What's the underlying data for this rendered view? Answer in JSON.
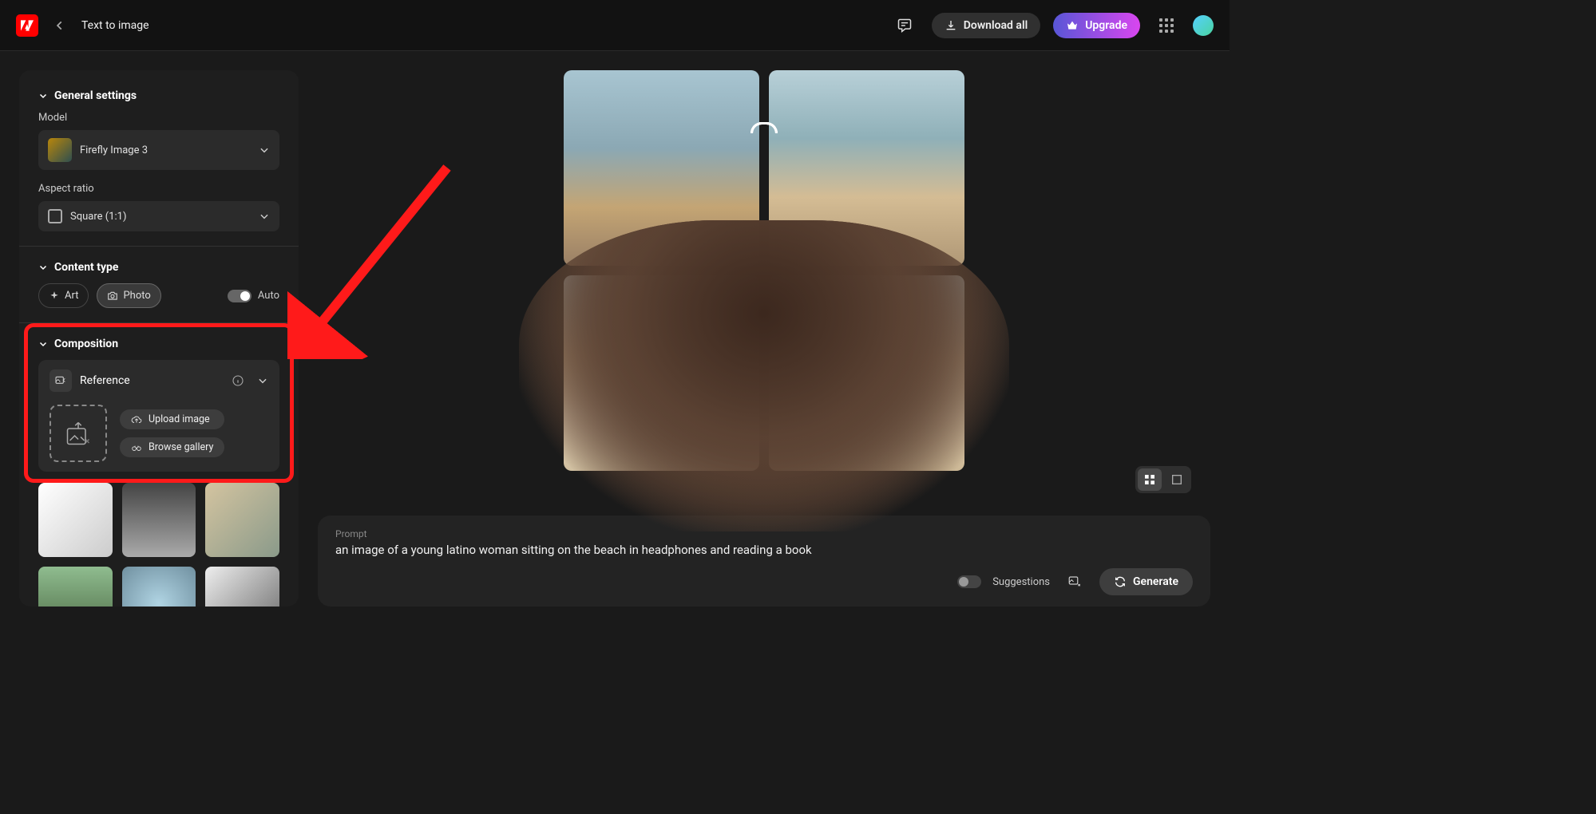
{
  "header": {
    "page_title": "Text to image",
    "download_all": "Download all",
    "upgrade": "Upgrade"
  },
  "sidebar": {
    "general": {
      "title": "General settings",
      "model_label": "Model",
      "model_value": "Firefly Image 3",
      "aspect_label": "Aspect ratio",
      "aspect_value": "Square (1:1)"
    },
    "content_type": {
      "title": "Content type",
      "art": "Art",
      "photo": "Photo",
      "auto": "Auto"
    },
    "composition": {
      "title": "Composition",
      "reference": "Reference",
      "upload": "Upload image",
      "browse": "Browse gallery"
    }
  },
  "prompt": {
    "label": "Prompt",
    "text": "an image of a young latino woman sitting on the beach in headphones and reading a book",
    "suggestions": "Suggestions",
    "generate": "Generate"
  },
  "annotation": {
    "type": "red-arrow-and-box",
    "target": "Composition section"
  }
}
